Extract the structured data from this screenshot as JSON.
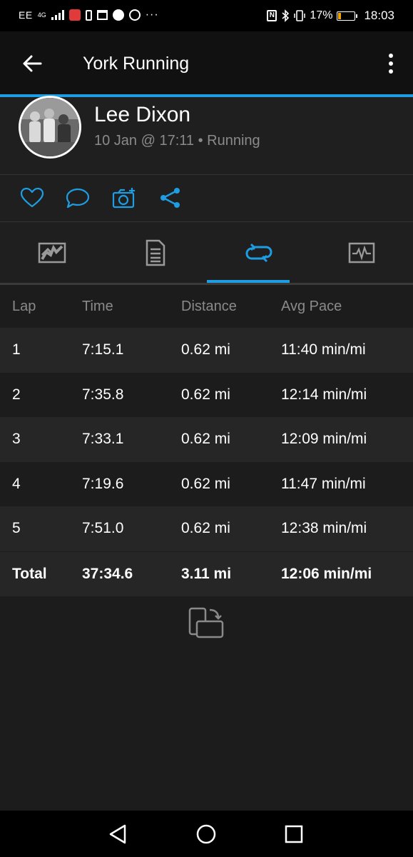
{
  "status_bar": {
    "carrier": "EE",
    "network": "4G",
    "battery_percent": "17%",
    "battery_level": 0.17,
    "time": "18:03",
    "icons": [
      "signal-icon",
      "huawei-app-icon",
      "sim-icon",
      "calendar-icon",
      "spotify-icon",
      "app-icon",
      "more-notifications-icon",
      "nfc-icon",
      "bluetooth-icon",
      "vibrate-icon",
      "battery-icon"
    ]
  },
  "app_bar": {
    "title": "York Running",
    "back_icon": "arrow-left-icon",
    "menu_icon": "more-vert-icon"
  },
  "activity": {
    "user_name": "Lee Dixon",
    "subtitle": "10 Jan @ 17:11 • Running"
  },
  "actions": [
    "heart-icon",
    "comment-icon",
    "add-photo-icon",
    "share-icon"
  ],
  "tabs": [
    {
      "name": "map-tab",
      "icon": "map-icon",
      "active": false
    },
    {
      "name": "stats-tab",
      "icon": "document-icon",
      "active": false
    },
    {
      "name": "laps-tab",
      "icon": "laps-icon",
      "active": true
    },
    {
      "name": "charts-tab",
      "icon": "chart-icon",
      "active": false
    }
  ],
  "laps": {
    "headers": [
      "Lap",
      "Time",
      "Distance",
      "Avg Pace"
    ],
    "rows": [
      [
        "1",
        "7:15.1",
        "0.62 mi",
        "11:40 min/mi"
      ],
      [
        "2",
        "7:35.8",
        "0.62 mi",
        "12:14 min/mi"
      ],
      [
        "3",
        "7:33.1",
        "0.62 mi",
        "12:09 min/mi"
      ],
      [
        "4",
        "7:19.6",
        "0.62 mi",
        "11:47 min/mi"
      ],
      [
        "5",
        "7:51.0",
        "0.62 mi",
        "12:38 min/mi"
      ]
    ],
    "total": [
      "Total",
      "37:34.6",
      "3.11 mi",
      "12:06 min/mi"
    ]
  },
  "colors": {
    "accent": "#1e9de3",
    "background": "#1c1c1c",
    "row_alt": "#262626",
    "muted_text": "#8a8a8a",
    "battery": "#f0a500"
  }
}
